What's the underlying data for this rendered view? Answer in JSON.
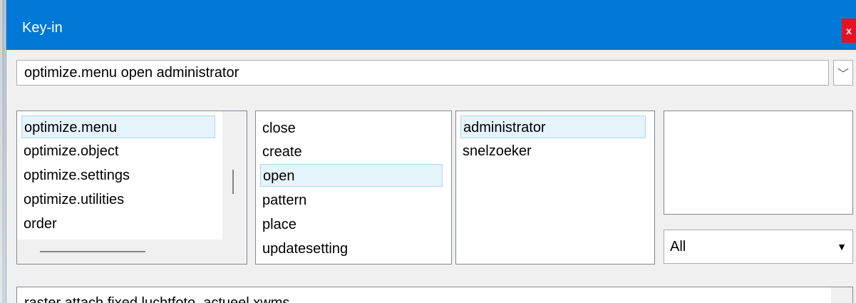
{
  "window": {
    "title": "Key-in",
    "close_label": "x"
  },
  "keyin": {
    "value": "optimize.menu open administrator",
    "dropdown_icon": "chevron-down-icon",
    "dropdown_glyph": "﹀"
  },
  "lists": {
    "verbs": [
      "optimize.menu",
      "optimize.object",
      "optimize.settings",
      "optimize.utilities",
      "order"
    ],
    "actions": [
      "close",
      "create",
      "open",
      "pattern",
      "place",
      "updatesetting"
    ],
    "targets": [
      "administrator",
      "snelzoeker"
    ]
  },
  "filter": {
    "selected": "All",
    "arrow": "▼"
  },
  "history": {
    "first_item": "raster attach fixed luchtfoto_actueel.xwms"
  },
  "colors": {
    "titlebar": "#0078d7",
    "close": "#e81123",
    "selection_bg": "#e5f3fb",
    "selection_border": "#a8d8f0"
  }
}
